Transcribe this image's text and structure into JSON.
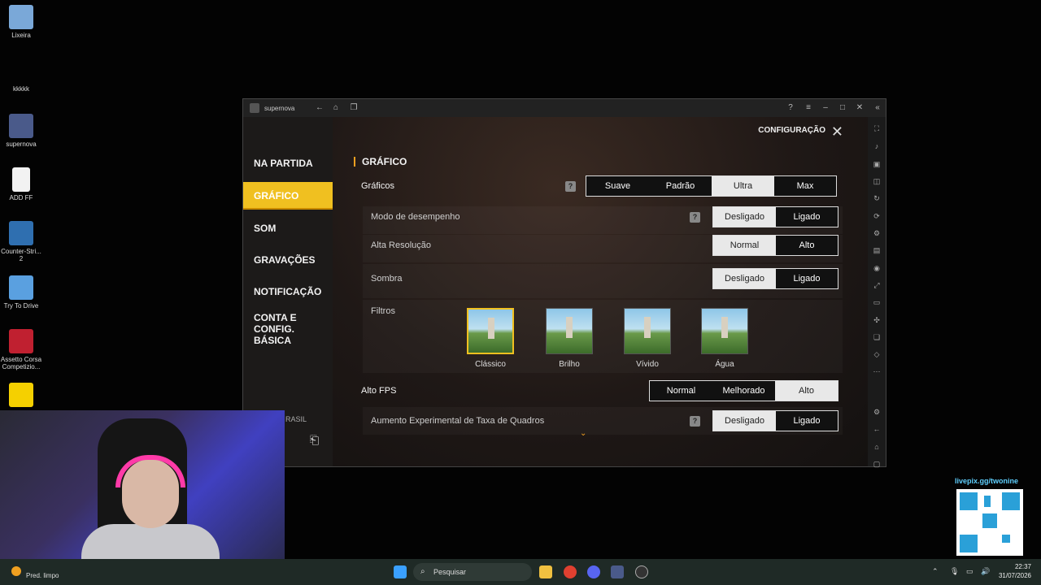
{
  "desktop": {
    "icons": [
      {
        "label": "Lixeira",
        "color": "#7aa8d8"
      },
      {
        "label": "kkkkk",
        "color": ""
      },
      {
        "label": "supernova",
        "color": "#4a5a8a"
      },
      {
        "label": "ADD FF",
        "color": "#f2f2f2"
      },
      {
        "label": "Counter-Stri... 2",
        "color": "#2f6fb0"
      },
      {
        "label": "Try To Drive",
        "color": "#5aa0e0"
      },
      {
        "label": "Assetto Corsa Competizio...",
        "color": "#c02030"
      },
      {
        "label": "",
        "color": "#f5d000"
      }
    ]
  },
  "emulator": {
    "title": "supernova",
    "subtitle": "",
    "titlebar_icons": [
      "back-icon",
      "home-icon",
      "multitask-icon",
      "help-icon",
      "menu-icon",
      "minimize-icon",
      "maximize-icon",
      "close-icon",
      "collapse-icon"
    ]
  },
  "game": {
    "config_title": "CONFIGURAÇÃO",
    "nav": [
      {
        "label": "NA PARTIDA"
      },
      {
        "label": "GRÁFICO"
      },
      {
        "label": "SOM"
      },
      {
        "label": "GRAVAÇÕES"
      },
      {
        "label": "NOTIFICAÇÃO"
      },
      {
        "label": "CONTA E CONFIG. BÁSICA"
      }
    ],
    "region_partial": "RASIL",
    "section_title": "GRÁFICO",
    "graficos": {
      "label": "Gráficos",
      "options": [
        "Suave",
        "Padrão",
        "Ultra",
        "Max"
      ],
      "selected": "Ultra"
    },
    "modo": {
      "label": "Modo de desempenho",
      "options": [
        "Desligado",
        "Ligado"
      ],
      "selected": "Desligado"
    },
    "alta_res": {
      "label": "Alta Resolução",
      "options": [
        "Normal",
        "Alto"
      ],
      "selected": "Normal"
    },
    "sombra": {
      "label": "Sombra",
      "options": [
        "Desligado",
        "Ligado"
      ],
      "selected": "Desligado"
    },
    "filtros": {
      "label": "Filtros",
      "items": [
        "Clássico",
        "Brilho",
        "Vívido",
        "Água"
      ],
      "selected": "Clássico"
    },
    "alto_fps": {
      "label": "Alto FPS",
      "options": [
        "Normal",
        "Melhorado",
        "Alto"
      ],
      "selected": "Alto"
    },
    "aumento": {
      "label": "Aumento Experimental de Taxa de Quadros",
      "options": [
        "Desligado",
        "Ligado"
      ],
      "selected": "Desligado"
    },
    "help_glyph": "?"
  },
  "overlay": {
    "donation_link": "livepix.gg/twonine"
  },
  "taskbar": {
    "weather": "Pred. limpo",
    "search_placeholder": "Pesquisar",
    "time": "22:37",
    "date": "31/07/2026"
  }
}
